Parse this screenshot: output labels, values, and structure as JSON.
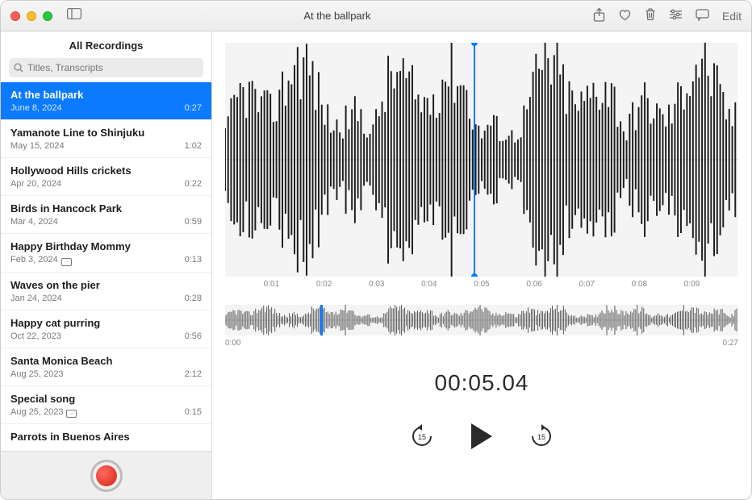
{
  "window": {
    "title": "At the ballpark",
    "edit_label": "Edit"
  },
  "sidebar": {
    "header": "All Recordings",
    "search_placeholder": "Titles, Transcripts",
    "items": [
      {
        "name": "At the ballpark",
        "date": "June 8, 2024",
        "dur": "0:27",
        "selected": true,
        "badge": false
      },
      {
        "name": "Yamanote Line to Shinjuku",
        "date": "May 15, 2024",
        "dur": "1:02",
        "selected": false,
        "badge": false
      },
      {
        "name": "Hollywood Hills crickets",
        "date": "Apr 20, 2024",
        "dur": "0:22",
        "selected": false,
        "badge": false
      },
      {
        "name": "Birds in Hancock Park",
        "date": "Mar 4, 2024",
        "dur": "0:59",
        "selected": false,
        "badge": false
      },
      {
        "name": "Happy Birthday Mommy",
        "date": "Feb 3, 2024",
        "dur": "0:13",
        "selected": false,
        "badge": true
      },
      {
        "name": "Waves on the pier",
        "date": "Jan 24, 2024",
        "dur": "0:28",
        "selected": false,
        "badge": false
      },
      {
        "name": "Happy cat purring",
        "date": "Oct 22, 2023",
        "dur": "0:56",
        "selected": false,
        "badge": false
      },
      {
        "name": "Santa Monica Beach",
        "date": "Aug 25, 2023",
        "dur": "2:12",
        "selected": false,
        "badge": false
      },
      {
        "name": "Special song",
        "date": "Aug 25, 2023",
        "dur": "0:15",
        "selected": false,
        "badge": true
      },
      {
        "name": "Parrots in Buenos Aires",
        "date": "",
        "dur": "",
        "selected": false,
        "badge": false
      }
    ]
  },
  "detail": {
    "ticks": [
      "",
      "0:01",
      "0:02",
      "0:03",
      "0:04",
      "0:05",
      "0:06",
      "0:07",
      "0:08",
      "0:09",
      ""
    ],
    "overview_start": "0:00",
    "overview_end": "0:27",
    "timecode": "00:05.04",
    "skip_amount": "15",
    "playhead_big_pct": 48.5,
    "playhead_small_pct": 18.5
  }
}
